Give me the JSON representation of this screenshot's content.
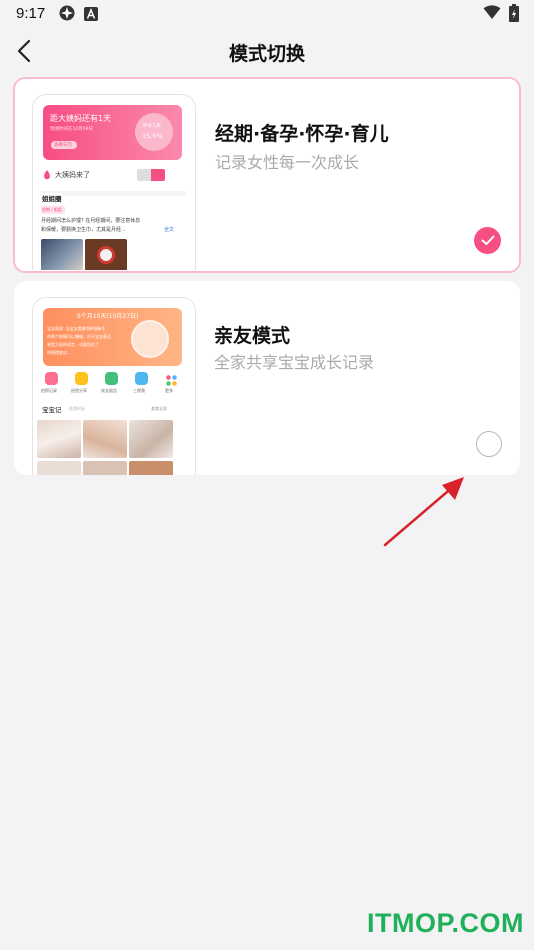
{
  "status_bar": {
    "time": "9:17"
  },
  "nav": {
    "title": "模式切换"
  },
  "modes": [
    {
      "title": "经期·备孕·怀孕·育儿",
      "subtitle": "记录女性每一次成长",
      "selected": true,
      "preview": {
        "banner_text": "距大姨妈还有1天",
        "banner_sub": "预测时间在10月09日",
        "banner_button": "查看日历",
        "flower_text": "怀孕几率",
        "flower_value": "15.0%",
        "row_text": "大姨妈来了",
        "section": "姐姐圈",
        "post_tag": "经期 / 姐姐",
        "post_text_1": "月经期间怎么护理? 在月经期间，要注意休息",
        "post_text_2": "和保暖，要勤换卫生巾，尤其是月经...",
        "post_more": "全文"
      }
    },
    {
      "title": "亲友模式",
      "subtitle": "全家共享宝宝成长记录",
      "selected": false,
      "preview": {
        "banner_title": "9个月10天(10月27日)",
        "banner_text_1": "宝宝萌发: 当宝宝看着你时候新生",
        "banner_text_2": "的两个眼睛可以慢慢，对于宝宝表达",
        "banner_text_3": "感受方面的语言，也要回应了",
        "banner_text_4": "的情绪变化...",
        "icon_labels": [
          "拍照记录",
          "经验分享",
          "成长报告",
          "三视频",
          "更多"
        ],
        "section": "宝宝记",
        "section_sub": "任务时长",
        "section_right": "查看全部"
      }
    }
  ],
  "watermark": "ITMOP.COM",
  "colors": {
    "accent": "#f64f82",
    "arrow": "#d8222b"
  }
}
